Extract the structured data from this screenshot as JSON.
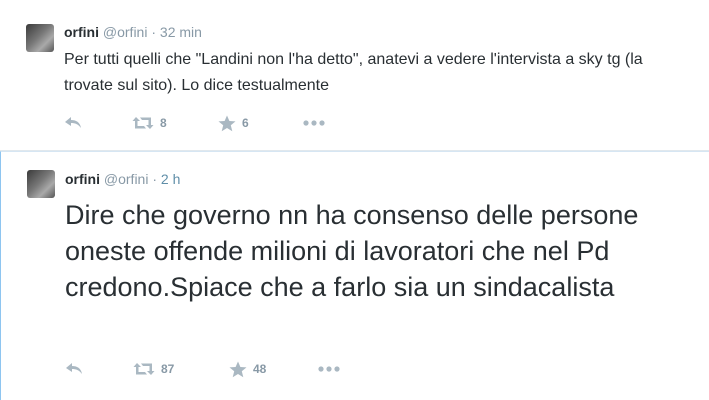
{
  "tweets": [
    {
      "name": "orfini",
      "handle": "@orfini",
      "separator": "·",
      "time": "32 min",
      "text": "Per tutti quelli che \"Landini non l'ha detto\", anatevi a vedere l'intervista a sky tg (la trovate sul sito). Lo dice testualmente",
      "retweets": "8",
      "favorites": "6"
    },
    {
      "name": "orfini",
      "handle": "@orfini",
      "separator": "·",
      "time": "2 h",
      "text": "Dire che governo nn ha consenso delle persone oneste offende milioni di lavoratori che nel Pd credono.Spiace che a farlo sia un sindacalista",
      "retweets": "87",
      "favorites": "48"
    }
  ],
  "icons": {
    "reply": "reply-icon",
    "retweet": "retweet-icon",
    "favorite": "star-icon",
    "more": "more-icon"
  },
  "colors": {
    "text": "#292f33",
    "muted": "#8899a6",
    "icon": "#aab8c2",
    "focus_border": "#8ec5f0"
  }
}
